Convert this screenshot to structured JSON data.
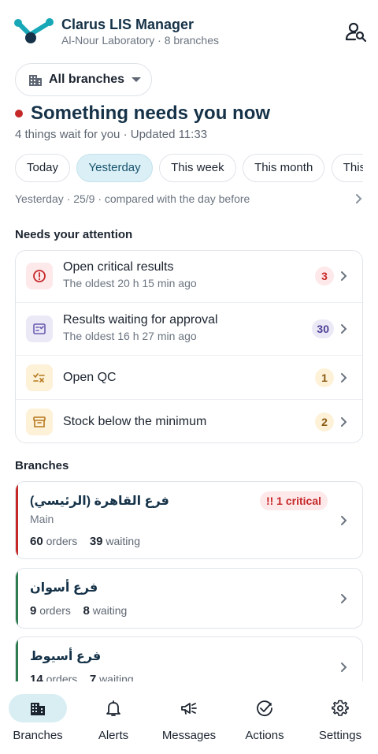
{
  "header": {
    "title": "Clarus LIS Manager",
    "subtitle": "Al-Nour Laboratory · 8 branches"
  },
  "branch_selector": {
    "label": "All branches"
  },
  "alert": {
    "title": "Something needs you now",
    "subtitle": "4 things wait for you · Updated 11:33"
  },
  "periods": {
    "chips": [
      "Today",
      "Yesterday",
      "This week",
      "This month",
      "This year"
    ],
    "selected": "Yesterday",
    "summary": "Yesterday · 25/9 · compared with the day before"
  },
  "attention": {
    "title": "Needs your attention",
    "items": [
      {
        "title": "Open critical results",
        "sub": "The oldest 20 h 15 min ago",
        "count": "3",
        "icon": "alert-circle-icon"
      },
      {
        "title": "Results waiting for approval",
        "sub": "The oldest 16 h 27 min ago",
        "count": "30",
        "icon": "approval-list-icon"
      },
      {
        "title": "Open QC",
        "sub": "",
        "count": "1",
        "icon": "qc-checklist-icon"
      },
      {
        "title": "Stock below the minimum",
        "sub": "",
        "count": "2",
        "icon": "archive-box-icon"
      }
    ]
  },
  "branches": {
    "title": "Branches",
    "orders_label": "orders",
    "waiting_label": "waiting",
    "items": [
      {
        "name": "فرع القاهرة (الرئيسي)",
        "role": "Main",
        "orders": "60",
        "waiting": "39",
        "critical": "!! 1 critical",
        "status": "critical"
      },
      {
        "name": "فرع أسوان",
        "role": "",
        "orders": "9",
        "waiting": "8",
        "critical": "",
        "status": "ok"
      },
      {
        "name": "فرع أسيوط",
        "role": "",
        "orders": "14",
        "waiting": "7",
        "critical": "",
        "status": "ok"
      }
    ]
  },
  "nav": {
    "items": [
      {
        "label": "Branches",
        "icon": "buildings-icon",
        "active": true
      },
      {
        "label": "Alerts",
        "icon": "bell-icon",
        "active": false
      },
      {
        "label": "Messages",
        "icon": "megaphone-icon",
        "active": false
      },
      {
        "label": "Actions",
        "icon": "check-circle-icon",
        "active": false
      },
      {
        "label": "Settings",
        "icon": "gear-icon",
        "active": false
      }
    ]
  },
  "colors": {
    "brand": "#17a7b7",
    "navy": "#153248",
    "critical": "#c62828",
    "ok": "#2e7d50",
    "chip_active_bg": "#dbeff6",
    "nav_active_bg": "#d9eef3"
  }
}
